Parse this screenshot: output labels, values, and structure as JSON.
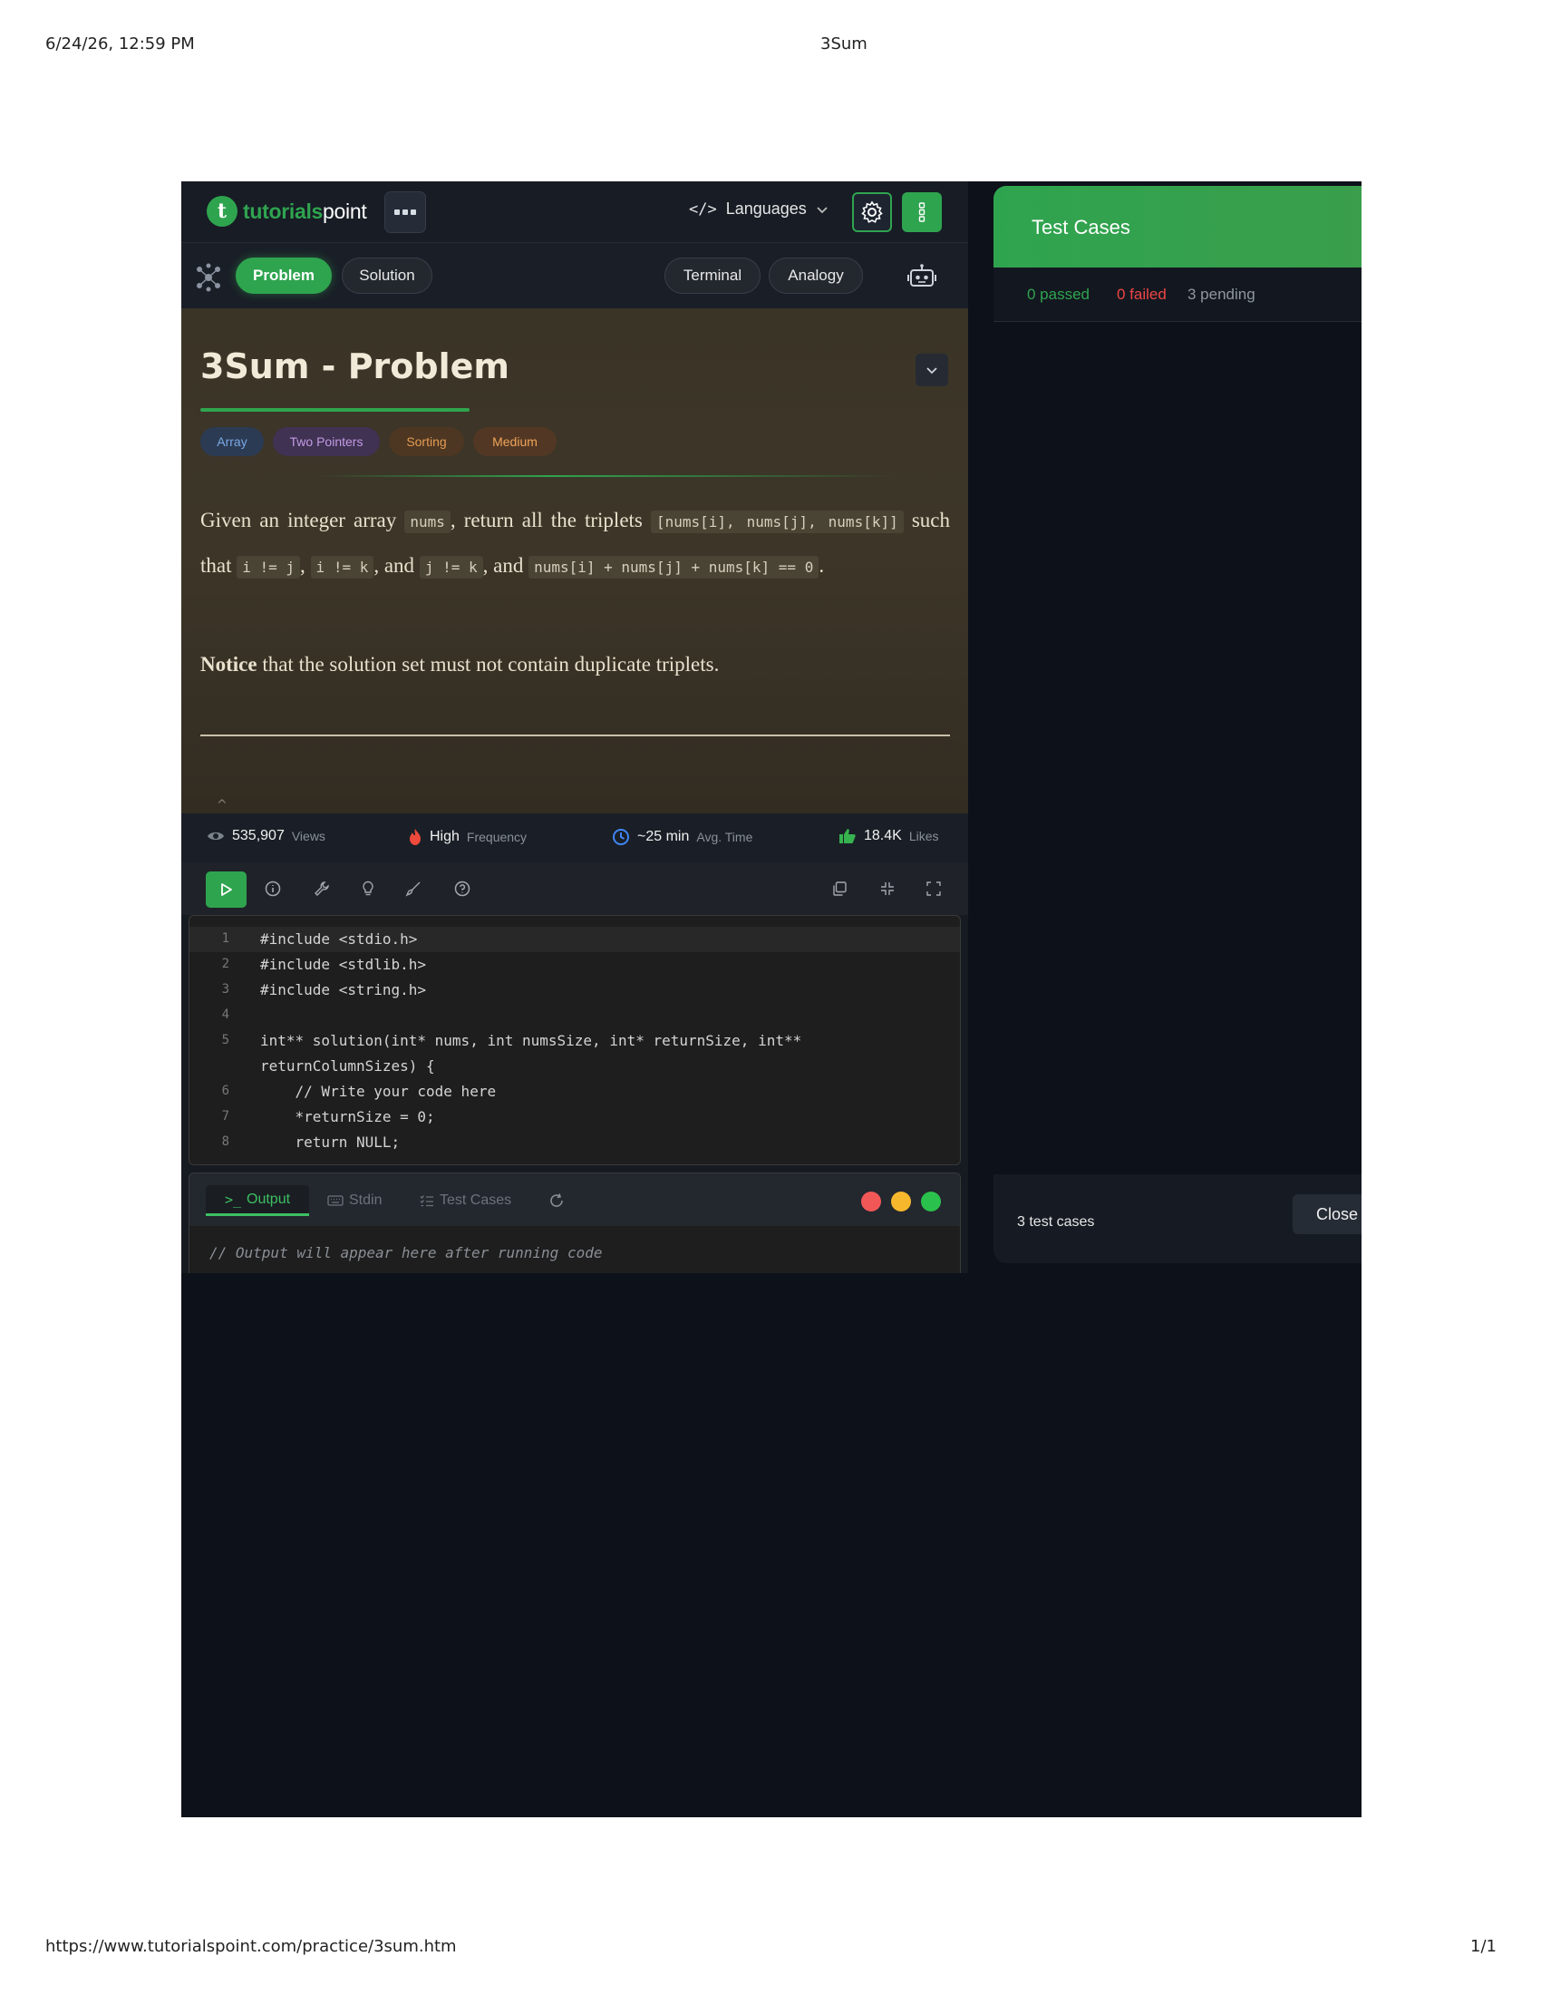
{
  "print_header": {
    "date": "6/24/26, 12:59 PM",
    "title": "3Sum"
  },
  "print_footer": {
    "url": "https://www.tutorialspoint.com/practice/3sum.htm",
    "page": "1/1"
  },
  "topbar": {
    "logo_brand": "tutorials",
    "logo_rest": "point",
    "languages_label": "Languages"
  },
  "tabs": {
    "problem": "Problem",
    "solution": "Solution",
    "terminal": "Terminal",
    "analogy": "Analogy"
  },
  "problem": {
    "title": "3Sum - Problem",
    "tags": [
      "Array",
      "Two Pointers",
      "Sorting",
      "Medium"
    ],
    "description": {
      "t1": "Given an integer array ",
      "c1": "nums",
      "t2": ", return all the triplets ",
      "c2": "[nums[i], nums[j], nums[k]]",
      "t3": " such that ",
      "c3": "i != j",
      "t4": ", ",
      "c4": "i != k",
      "t5": ", and ",
      "c5": "j != k",
      "t6": ", and ",
      "c6": "nums[i] + nums[j] + nums[k] == 0",
      "t7": "."
    },
    "notice_bold": "Notice",
    "notice_rest": " that the solution set must not contain duplicate triplets."
  },
  "stats": {
    "views_value": "535,907",
    "views_label": "Views",
    "frequency_value": "High",
    "frequency_label": "Frequency",
    "time_value": "~25 min",
    "time_label": "Avg. Time",
    "likes_value": "18.4K",
    "likes_label": "Likes"
  },
  "editor": {
    "lines": [
      {
        "n": "1",
        "code": "#include <stdio.h>"
      },
      {
        "n": "2",
        "code": "#include <stdlib.h>"
      },
      {
        "n": "3",
        "code": "#include <string.h>"
      },
      {
        "n": "4",
        "code": ""
      },
      {
        "n": "5",
        "code": "int** solution(int* nums, int numsSize, int* returnSize, int**"
      },
      {
        "n": "",
        "code": "returnColumnSizes) {"
      },
      {
        "n": "6",
        "code": "    // Write your code here"
      },
      {
        "n": "7",
        "code": "    *returnSize = 0;"
      },
      {
        "n": "8",
        "code": "    return NULL;"
      }
    ]
  },
  "output": {
    "tab_output": "Output",
    "tab_stdin": "Stdin",
    "tab_testcases": "Test Cases",
    "placeholder": "// Output will appear here after running code"
  },
  "test_cases": {
    "title": "Test Cases",
    "passed": "0 passed",
    "failed": "0 failed",
    "pending": "3 pending",
    "count": "3 test cases",
    "close_label": "Close"
  },
  "colors": {
    "accent": "#2fa44f",
    "failed": "#ef4444",
    "tag_array": "#7aa9e6",
    "tag_two_pointers": "#c49ae6",
    "tag_sorting": "#e59b52",
    "tag_medium": "#f0a35a"
  }
}
